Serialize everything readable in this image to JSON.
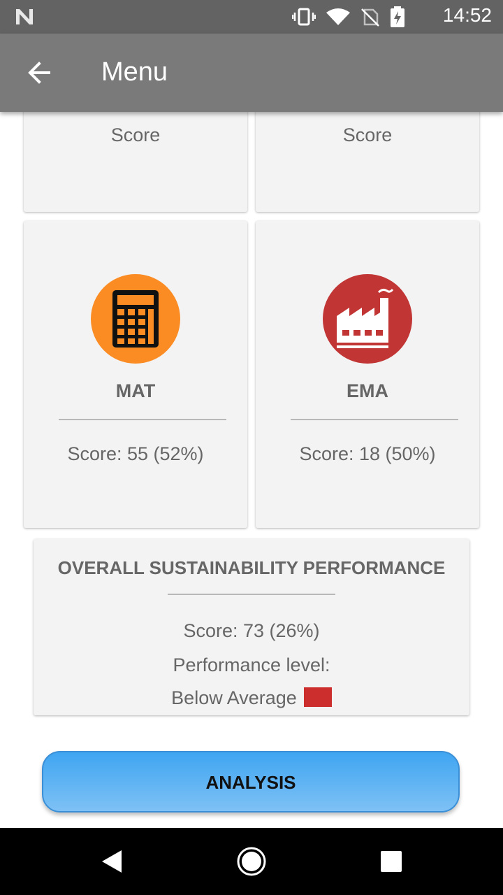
{
  "status_bar": {
    "time": "14:52"
  },
  "app_bar": {
    "title": "Menu"
  },
  "top_cards": [
    {
      "label": "Score"
    },
    {
      "label": "Score"
    }
  ],
  "categories": [
    {
      "name": "MAT",
      "score": "Score: 55 (52%)",
      "icon": "calculator-icon",
      "color": "#fb8c23"
    },
    {
      "name": "EMA",
      "score": "Score: 18 (50%)",
      "icon": "factory-icon",
      "color": "#c23535"
    }
  ],
  "overall": {
    "title": "OVERALL SUSTAINABILITY PERFORMANCE",
    "score": "Score: 73 (26%)",
    "level_label": "Performance level:",
    "level_value": "Below Average",
    "level_color": "#cc2e2e"
  },
  "analysis_button": {
    "label": "ANALYSIS"
  }
}
